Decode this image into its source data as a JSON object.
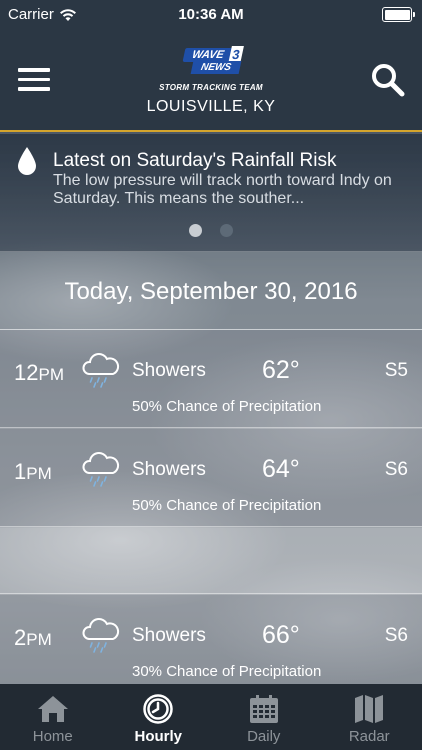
{
  "status_bar": {
    "carrier": "Carrier",
    "time": "10:36 AM",
    "wifi_icon": "wifi-icon",
    "battery_icon": "battery-icon"
  },
  "header": {
    "logo_wave": "WAVE",
    "logo_three": "3",
    "logo_news": "NEWS",
    "logo_sub": "STORM TRACKING TEAM",
    "location": "LOUISVILLE, KY",
    "menu_icon": "menu-icon",
    "search_icon": "search-icon",
    "accent_color": "#d4a52c"
  },
  "news": {
    "icon": "raindrop-icon",
    "title": "Latest on Saturday's Rainfall Risk",
    "body": "The low pressure will track north toward Indy on Saturday.  This means the souther...",
    "page_count": 2,
    "active_page": 1
  },
  "date_header": "Today, September 30, 2016",
  "hours": [
    {
      "hour": "12",
      "ampm": "PM",
      "icon": "cloud-rain-icon",
      "condition": "Showers",
      "temp": "62°",
      "wind": "S5",
      "precip": "50% Chance of Precipitation"
    },
    {
      "hour": "1",
      "ampm": "PM",
      "icon": "cloud-rain-icon",
      "condition": "Showers",
      "temp": "64°",
      "wind": "S6",
      "precip": "50% Chance of Precipitation"
    },
    {
      "hour": "2",
      "ampm": "PM",
      "icon": "cloud-rain-icon",
      "condition": "Showers",
      "temp": "66°",
      "wind": "S6",
      "precip": "30% Chance of Precipitation"
    }
  ],
  "tabs": [
    {
      "label": "Home",
      "icon": "home-icon",
      "active": false
    },
    {
      "label": "Hourly",
      "icon": "clock-icon",
      "active": true
    },
    {
      "label": "Daily",
      "icon": "calendar-icon",
      "active": false
    },
    {
      "label": "Radar",
      "icon": "map-icon",
      "active": false
    }
  ]
}
